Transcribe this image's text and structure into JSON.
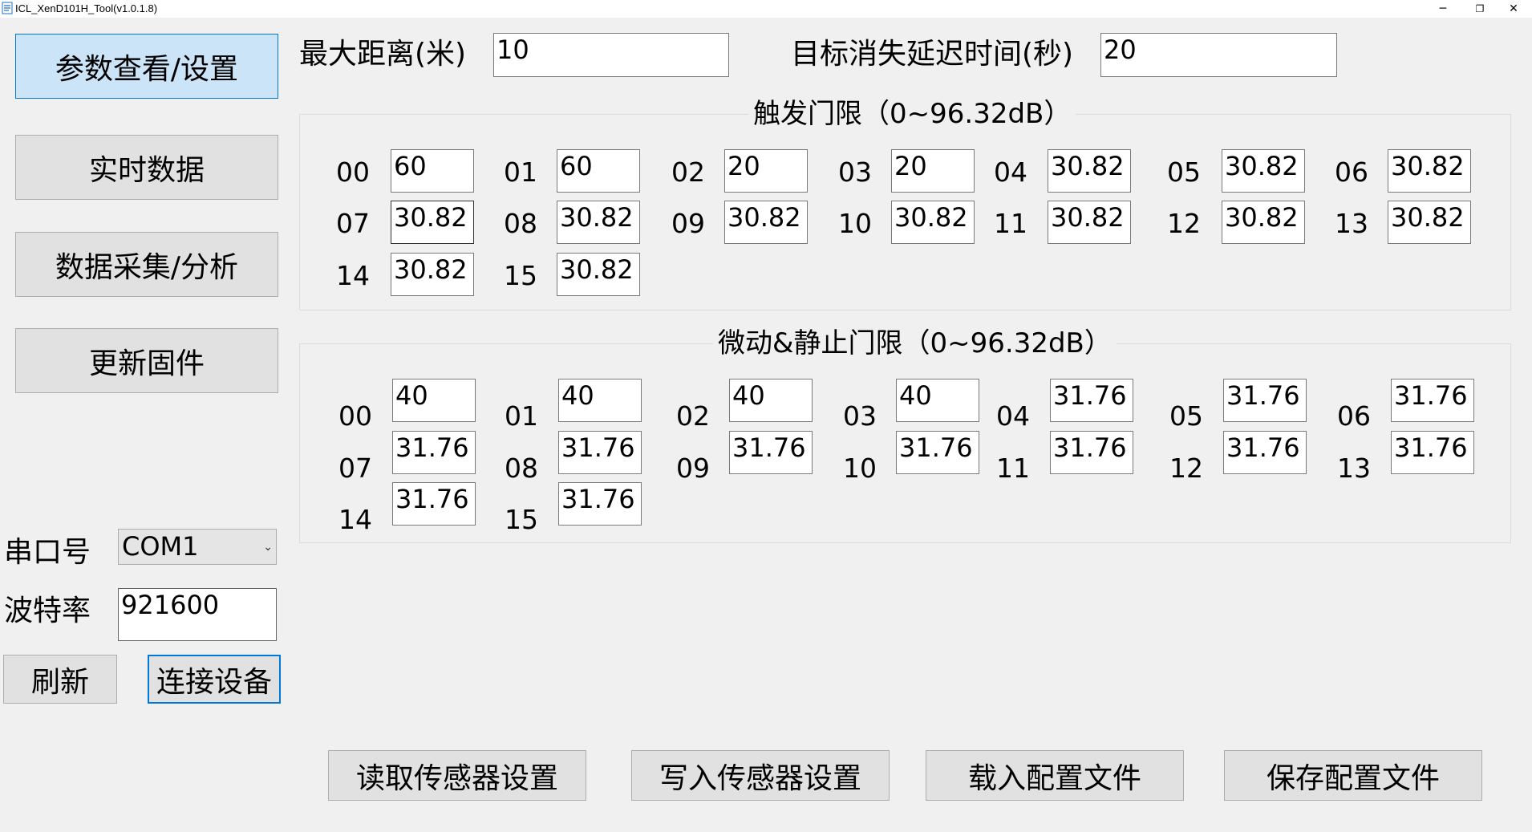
{
  "window": {
    "title": "ICL_XenD101H_Tool(v1.0.1.8)",
    "icon": "app-icon",
    "controls": [
      "─",
      "❐",
      "✕"
    ]
  },
  "nav": [
    {
      "label": "参数查看/设置",
      "active": true
    },
    {
      "label": "实时数据",
      "active": false
    },
    {
      "label": "数据采集/分析",
      "active": false
    },
    {
      "label": "更新固件",
      "active": false
    }
  ],
  "params": {
    "max_distance_label": "最大距离(米)",
    "max_distance_value": "10",
    "delay_label": "目标消失延迟时间(秒)",
    "delay_value": "20"
  },
  "trigger": {
    "title": "触发门限（0~96.32dB）",
    "gates": [
      {
        "id": "00",
        "value": "60"
      },
      {
        "id": "01",
        "value": "60"
      },
      {
        "id": "02",
        "value": "20"
      },
      {
        "id": "03",
        "value": "20"
      },
      {
        "id": "04",
        "value": "30.82"
      },
      {
        "id": "05",
        "value": "30.82"
      },
      {
        "id": "06",
        "value": "30.82"
      },
      {
        "id": "07",
        "value": "30.82"
      },
      {
        "id": "08",
        "value": "30.82"
      },
      {
        "id": "09",
        "value": "30.82"
      },
      {
        "id": "10",
        "value": "30.82"
      },
      {
        "id": "11",
        "value": "30.82"
      },
      {
        "id": "12",
        "value": "30.82"
      },
      {
        "id": "13",
        "value": "30.82"
      },
      {
        "id": "14",
        "value": "30.82"
      },
      {
        "id": "15",
        "value": "30.82"
      }
    ]
  },
  "static": {
    "title": "微动&静止门限（0~96.32dB）",
    "gates": [
      {
        "id": "00",
        "value": "40"
      },
      {
        "id": "01",
        "value": "40"
      },
      {
        "id": "02",
        "value": "40"
      },
      {
        "id": "03",
        "value": "40"
      },
      {
        "id": "04",
        "value": "31.76"
      },
      {
        "id": "05",
        "value": "31.76"
      },
      {
        "id": "06",
        "value": "31.76"
      },
      {
        "id": "07",
        "value": "31.76"
      },
      {
        "id": "08",
        "value": "31.76"
      },
      {
        "id": "09",
        "value": "31.76"
      },
      {
        "id": "10",
        "value": "31.76"
      },
      {
        "id": "11",
        "value": "31.76"
      },
      {
        "id": "12",
        "value": "31.76"
      },
      {
        "id": "13",
        "value": "31.76"
      },
      {
        "id": "14",
        "value": "31.76"
      },
      {
        "id": "15",
        "value": "31.76"
      }
    ]
  },
  "serial": {
    "port_label": "串口号",
    "port_value": "COM1",
    "baud_label": "波特率",
    "baud_value": "921600",
    "refresh_label": "刷新",
    "connect_label": "连接设备"
  },
  "actions": {
    "read_label": "读取传感器设置",
    "write_label": "写入传感器设置",
    "load_label": "载入配置文件",
    "save_label": "保存配置文件"
  }
}
